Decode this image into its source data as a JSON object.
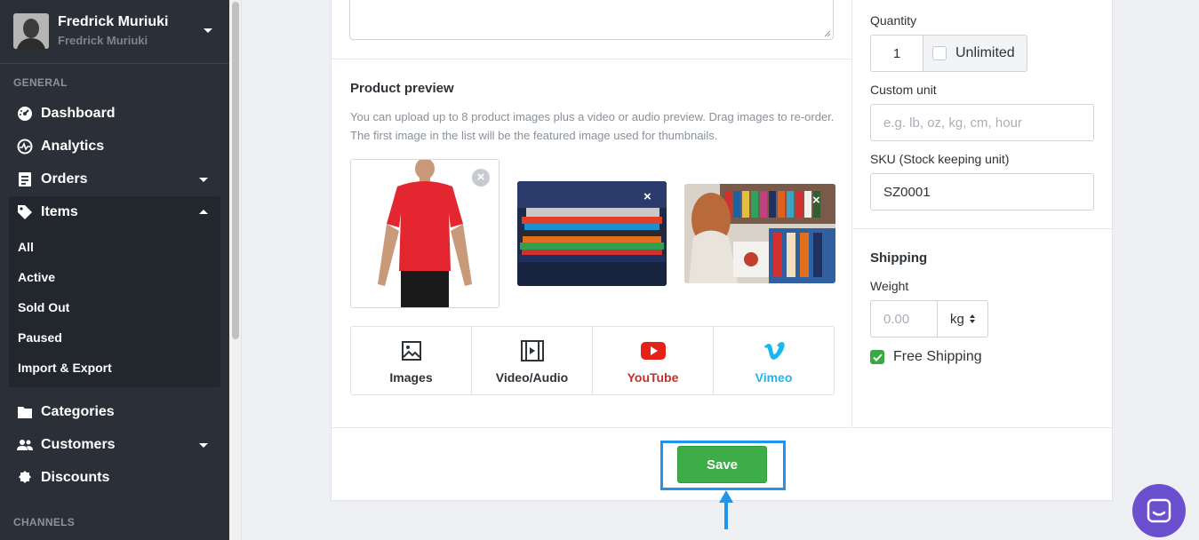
{
  "user": {
    "name": "Fredrick Muriuki",
    "subtitle": "Fredrick Muriuki"
  },
  "sidebar": {
    "general_label": "GENERAL",
    "channels_label": "CHANNELS",
    "items": [
      {
        "label": "Dashboard",
        "icon": "dashboard-icon"
      },
      {
        "label": "Analytics",
        "icon": "analytics-icon"
      },
      {
        "label": "Orders",
        "icon": "orders-icon"
      },
      {
        "label": "Items",
        "icon": "tag-icon"
      },
      {
        "label": "Categories",
        "icon": "folder-icon"
      },
      {
        "label": "Customers",
        "icon": "people-icon"
      },
      {
        "label": "Discounts",
        "icon": "discount-icon"
      }
    ],
    "sub_items": [
      "All",
      "Active",
      "Sold Out",
      "Paused",
      "Import & Export"
    ]
  },
  "product_preview": {
    "title": "Product preview",
    "description": "You can upload up to 8 product images plus a video or audio preview. Drag images to re-order. The first image in the list will be the featured image used for thumbnails.",
    "media_buttons": [
      {
        "label": "Images",
        "icon": "image-icon",
        "color": "#2e3338"
      },
      {
        "label": "Video/Audio",
        "icon": "film-icon",
        "color": "#2e3338"
      },
      {
        "label": "YouTube",
        "icon": "youtube-icon",
        "color": "#c4302b"
      },
      {
        "label": "Vimeo",
        "icon": "vimeo-icon",
        "color": "#1ab7ea"
      }
    ]
  },
  "inventory": {
    "quantity_label": "Quantity",
    "quantity_value": "1",
    "unlimited_label": "Unlimited",
    "custom_unit_label": "Custom unit",
    "custom_unit_placeholder": "e.g. lb, oz, kg, cm, hour",
    "sku_label": "SKU (Stock keeping unit)",
    "sku_value": "SZ0001"
  },
  "shipping": {
    "title": "Shipping",
    "weight_label": "Weight",
    "weight_placeholder": "0.00",
    "unit_value": "kg",
    "free_shipping_label": "Free Shipping",
    "free_shipping_checked": true
  },
  "actions": {
    "save_label": "Save"
  },
  "colors": {
    "sidebar_bg": "#2b3038",
    "save_green": "#3dae47",
    "highlight_blue": "#1e96f0",
    "chat_purple": "#6a4fcf"
  }
}
